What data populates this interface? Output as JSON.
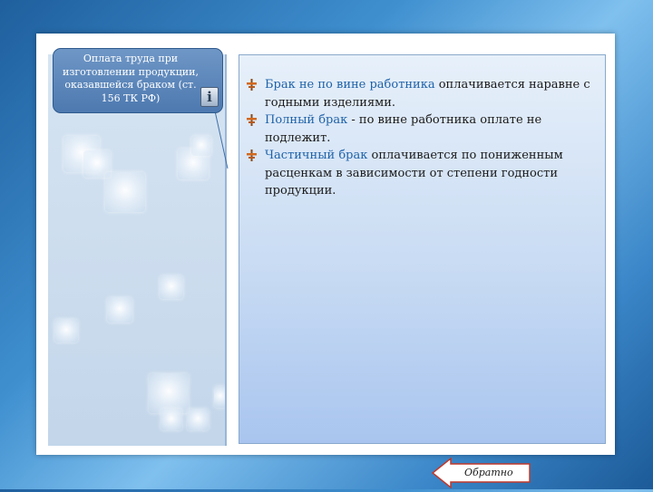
{
  "callout": {
    "text": "Оплата труда при изготовлении продукции, оказавшейся браком (ст. 156 ТК РФ)",
    "icon": "info-icon",
    "icon_glyph": "i"
  },
  "bullets": [
    {
      "term": "Брак не по вине работника",
      "text": " оплачивается наравне с годными изделиями."
    },
    {
      "term": "Полный брак",
      "text": " - по вине работника оплате не подлежит."
    },
    {
      "term": "Частичный брак",
      "text": " оплачивается по пониженным расценкам в зависимости от степени годности продукции."
    }
  ],
  "nav": {
    "back_label": "Обратно"
  },
  "colors": {
    "term": "#1f62a8",
    "callout": "#5a85bb",
    "bullet_marker": "#d2691e"
  }
}
